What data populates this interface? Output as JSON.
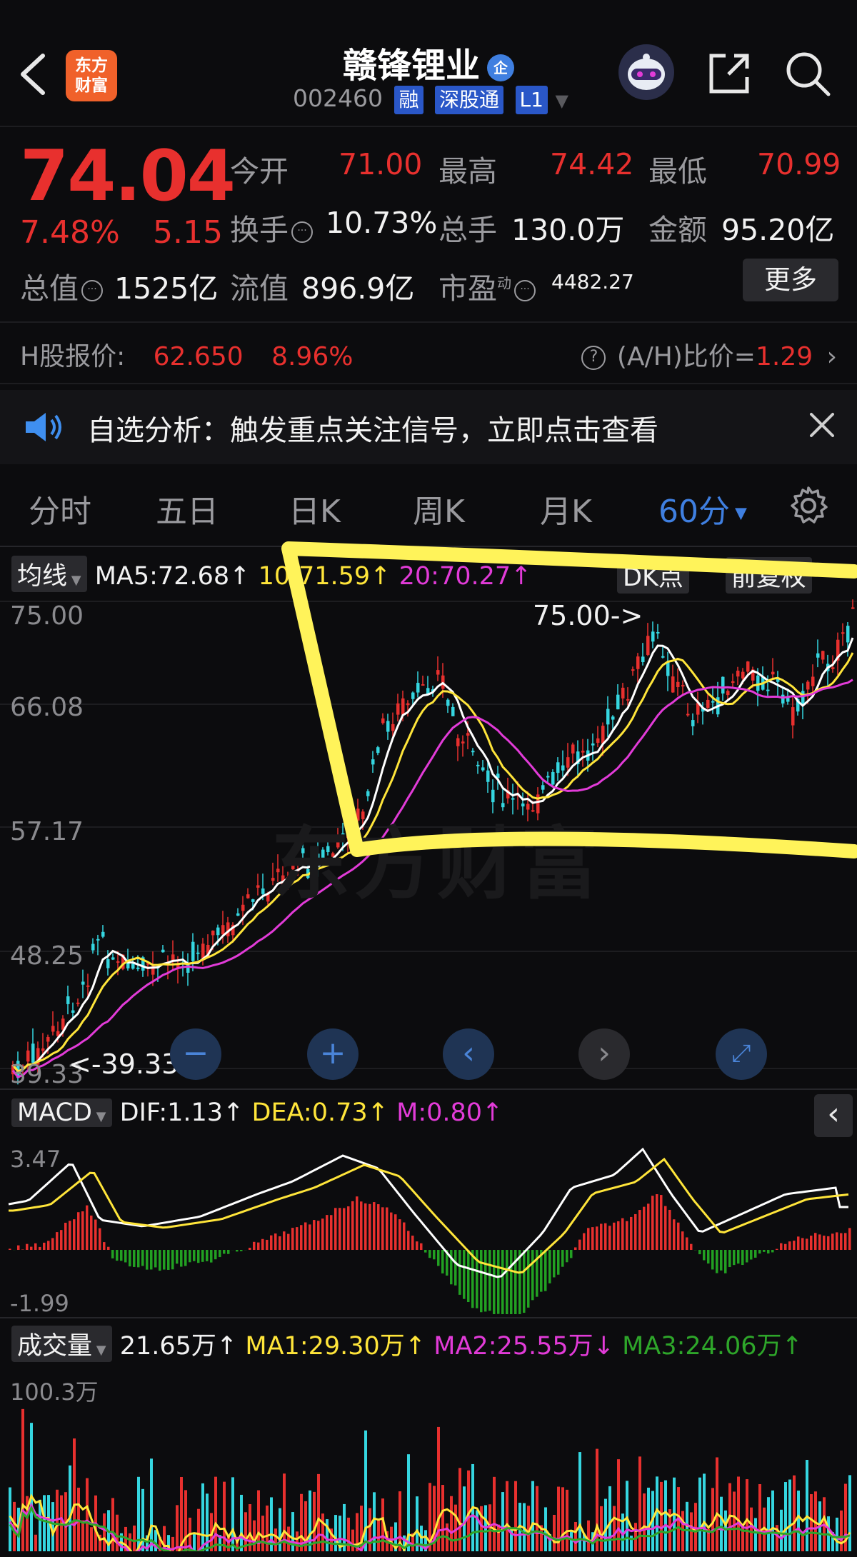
{
  "header": {
    "logo_line1": "东方",
    "logo_line2": "财富",
    "stock_name": "赣锋锂业",
    "badge": "企",
    "code": "002460",
    "tags": [
      "融",
      "深股通",
      "L1"
    ]
  },
  "quote": {
    "price": "74.04",
    "change_pct": "7.48%",
    "change_abs": "5.15",
    "open_label": "今开",
    "open": "71.00",
    "high_label": "最高",
    "high": "74.42",
    "low_label": "最低",
    "low": "70.99",
    "turnover_label": "换手",
    "turnover": "10.73%",
    "volume_label": "总手",
    "volume": "130.0万",
    "amount_label": "金额",
    "amount": "95.20亿",
    "mktcap_label": "总值",
    "mktcap": "1525亿",
    "float_label": "流值",
    "float_cap": "896.9亿",
    "pe_label": "市盈",
    "pe_sup": "动",
    "pe": "4482.27",
    "more_label": "更多"
  },
  "hshare": {
    "label": "H股报价:",
    "price": "62.650",
    "pct": "8.96%",
    "ah_label": "(A/H)比价=",
    "ah_value": "1.29"
  },
  "banner": {
    "text": "自选分析：触发重点关注信号，立即点击查看"
  },
  "tabs": [
    "分时",
    "五日",
    "日K",
    "周K",
    "月K",
    "60分"
  ],
  "tabs_active_index": 5,
  "ma_row": {
    "selector": "均线",
    "ma5": "MA5:72.68",
    "ma10": "10:71.59",
    "ma20": "20:70.27",
    "right1": "DK点",
    "right2": "前复权"
  },
  "main_axis": [
    "75.00",
    "66.08",
    "57.17",
    "48.25",
    "39.33"
  ],
  "annotations": {
    "high": "75.00->",
    "low": "<-39.33"
  },
  "nav_buttons": [
    "−",
    "+",
    "‹",
    "›",
    "⤢"
  ],
  "macd": {
    "selector": "MACD",
    "dif": "DIF:1.13",
    "dea": "DEA:0.73",
    "m": "M:0.80",
    "axis_top": "3.47",
    "axis_bottom": "-1.99"
  },
  "volume": {
    "selector": "成交量",
    "vol": "21.65万",
    "ma1": "MA1:29.30万",
    "ma2": "MA2:25.55万",
    "ma3": "MA3:24.06万",
    "axis_top": "100.3万"
  },
  "watermark": "东方财富",
  "colors": {
    "up": "#e8302e",
    "down": "#35d6e0",
    "ma5": "#ffffff",
    "ma10": "#ffe53a",
    "ma20": "#e23bd8",
    "accent": "#3f7fe0",
    "highlight": "#fff35a"
  }
}
